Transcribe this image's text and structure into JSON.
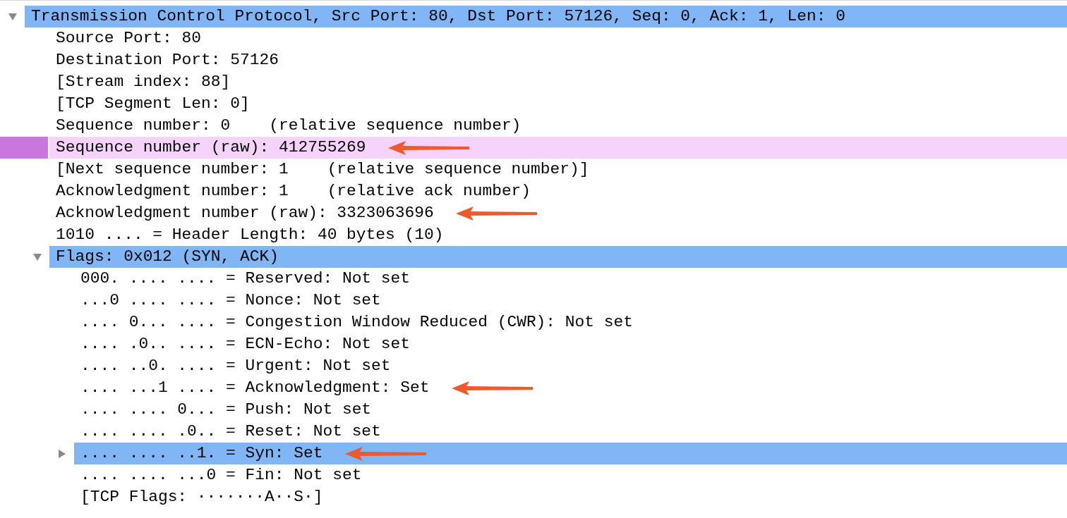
{
  "tree": [
    {
      "text": "Transmission Control Protocol, Src Port: 80, Dst Port: 57126, Seq: 0, Ack: 1, Len: 0",
      "selected": true,
      "highlighted": false,
      "arrow": false,
      "expanded": true,
      "children": [
        {
          "text": "Source Port: 80",
          "selected": false,
          "highlighted": false,
          "arrow": false
        },
        {
          "text": "Destination Port: 57126",
          "selected": false,
          "highlighted": false,
          "arrow": false
        },
        {
          "text": "[Stream index: 88]",
          "selected": false,
          "highlighted": false,
          "arrow": false
        },
        {
          "text": "[TCP Segment Len: 0]",
          "selected": false,
          "highlighted": false,
          "arrow": false
        },
        {
          "text": "Sequence number: 0    (relative sequence number)",
          "selected": false,
          "highlighted": false,
          "arrow": false
        },
        {
          "text": "Sequence number (raw): 412755269",
          "selected": false,
          "highlighted": true,
          "arrow": true
        },
        {
          "text": "[Next sequence number: 1    (relative sequence number)]",
          "selected": false,
          "highlighted": false,
          "arrow": false
        },
        {
          "text": "Acknowledgment number: 1    (relative ack number)",
          "selected": false,
          "highlighted": false,
          "arrow": false
        },
        {
          "text": "Acknowledgment number (raw): 3323063696",
          "selected": false,
          "highlighted": false,
          "arrow": true
        },
        {
          "text": "1010 .... = Header Length: 40 bytes (10)",
          "selected": false,
          "highlighted": false,
          "arrow": false
        },
        {
          "text": "Flags: 0x012 (SYN, ACK)",
          "selected": true,
          "highlighted": false,
          "arrow": false,
          "expanded": true,
          "children": [
            {
              "text": "000. .... .... = Reserved: Not set",
              "selected": false,
              "highlighted": false,
              "arrow": false
            },
            {
              "text": "...0 .... .... = Nonce: Not set",
              "selected": false,
              "highlighted": false,
              "arrow": false
            },
            {
              "text": ".... 0... .... = Congestion Window Reduced (CWR): Not set",
              "selected": false,
              "highlighted": false,
              "arrow": false
            },
            {
              "text": ".... .0.. .... = ECN-Echo: Not set",
              "selected": false,
              "highlighted": false,
              "arrow": false
            },
            {
              "text": ".... ..0. .... = Urgent: Not set",
              "selected": false,
              "highlighted": false,
              "arrow": false
            },
            {
              "text": ".... ...1 .... = Acknowledgment: Set",
              "selected": false,
              "highlighted": false,
              "arrow": true
            },
            {
              "text": ".... .... 0... = Push: Not set",
              "selected": false,
              "highlighted": false,
              "arrow": false
            },
            {
              "text": ".... .... .0.. = Reset: Not set",
              "selected": false,
              "highlighted": false,
              "arrow": false
            },
            {
              "text": ".... .... ..1. = Syn: Set",
              "selected": true,
              "highlighted": false,
              "arrow": true,
              "expanded": false
            },
            {
              "text": ".... .... ...0 = Fin: Not set",
              "selected": false,
              "highlighted": false,
              "arrow": false
            },
            {
              "text": "[TCP Flags: ·······A··S·]",
              "selected": false,
              "highlighted": false,
              "arrow": false
            }
          ]
        }
      ]
    }
  ]
}
